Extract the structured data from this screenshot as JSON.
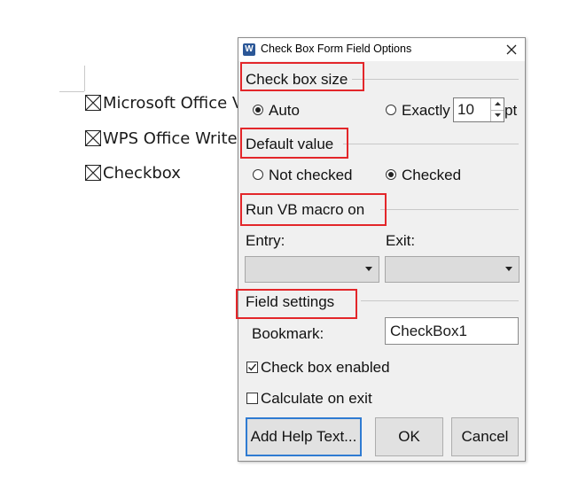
{
  "document": {
    "items": [
      {
        "label": "Microsoft Office V"
      },
      {
        "label": "WPS Office Write"
      },
      {
        "label": "Checkbox"
      }
    ]
  },
  "dialog": {
    "title": "Check Box Form Field Options",
    "app_icon": "W",
    "check_box_size": {
      "heading": "Check box size",
      "auto_label": "Auto",
      "exactly_label": "Exactly",
      "exactly_value": "10",
      "unit": "pt",
      "selected": "Auto"
    },
    "default_value": {
      "heading": "Default value",
      "not_checked_label": "Not checked",
      "checked_label": "Checked",
      "selected": "Checked"
    },
    "run_macro": {
      "heading": "Run VB macro on",
      "entry_label": "Entry:",
      "exit_label": "Exit:",
      "entry_value": "",
      "exit_value": ""
    },
    "field_settings": {
      "heading": "Field settings",
      "bookmark_label": "Bookmark:",
      "bookmark_value": "CheckBox1",
      "enabled_label": "Check box enabled",
      "enabled_checked": true,
      "calc_label": "Calculate on exit",
      "calc_checked": false
    },
    "buttons": {
      "help": "Add Help Text...",
      "ok": "OK",
      "cancel": "Cancel"
    },
    "highlight_color": "#e3262a",
    "default_button_border": "#2f7bd2"
  }
}
